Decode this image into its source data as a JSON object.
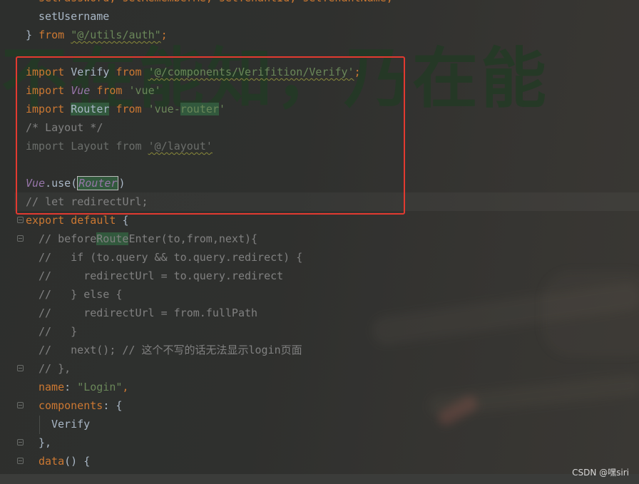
{
  "background": {
    "artwork_text": "不在能知，乃在能"
  },
  "code": {
    "l01": {
      "a": "setPassword",
      "b": ", ",
      "c": "setRememberMe",
      "d": ", ",
      "e": "setTenantId",
      "f": ", ",
      "g": "setTenantName",
      "h": ","
    },
    "l02": {
      "a": "setUsername"
    },
    "l03": {
      "a": "} ",
      "b": "from",
      "c": " ",
      "d": "\"@/utils/auth\"",
      "e": ";"
    },
    "l04": {
      "a": "import",
      "b": " Verify ",
      "c": "from",
      "d": " ",
      "e": "'@/components/Verifition/Verify'",
      "f": ";"
    },
    "l05": {
      "a": "import",
      "b": " ",
      "c": "Vue",
      "d": " ",
      "e": "from",
      "f": " ",
      "g": "'vue'"
    },
    "l06": {
      "a": "import",
      "b": " ",
      "c": "Router",
      "d": " ",
      "e": "from",
      "f": " ",
      "g": "'vue-",
      "h": "router",
      "i": "'"
    },
    "l07": {
      "a": "/* Layout */"
    },
    "l08": {
      "a": "import Layout from ",
      "b": "'@/layout'"
    },
    "l09": {
      "a": "Vue",
      "b": ".use(",
      "c": "Router",
      "d": ")"
    },
    "l10": {
      "a": "// let redirectUrl;"
    },
    "l11": {
      "a": "export default",
      "b": " {"
    },
    "l12": {
      "a": "// before",
      "b": "Route",
      "c": "Enter(to,from,next){"
    },
    "l13": {
      "a": "//   if (to.query && to.query.redirect) {"
    },
    "l14": {
      "a": "//     redirectUrl = to.query.redirect"
    },
    "l15": {
      "a": "//   } else {"
    },
    "l16": {
      "a": "//     redirectUrl = from.fullPath"
    },
    "l17": {
      "a": "//   }"
    },
    "l18": {
      "a": "//   next(); // 这个不写的话无法显示login页面"
    },
    "l19": {
      "a": "// },"
    },
    "l20": {
      "a": "name",
      "b": ": ",
      "c": "\"Login\"",
      "d": ","
    },
    "l21": {
      "a": "components",
      "b": ": {"
    },
    "l22": {
      "a": "Verify"
    },
    "l23": {
      "a": "},"
    },
    "l24": {
      "a": "data",
      "b": "() {"
    }
  },
  "watermark": "CSDN @嘿siri",
  "colors": {
    "keyword": "#cc7832",
    "string": "#6a8759",
    "comment": "#808080",
    "identifier": "#a9b7c6",
    "vue_italic": "#9876aa",
    "annotation_red": "#e23a30",
    "highlight_green": "#32593d"
  }
}
